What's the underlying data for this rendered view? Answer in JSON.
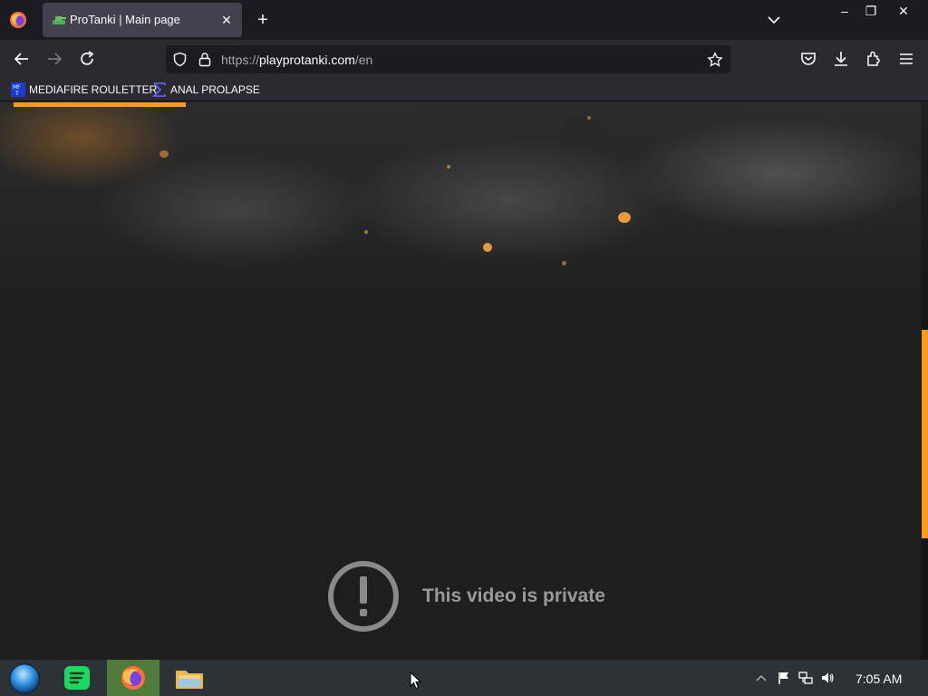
{
  "browser": {
    "tab": {
      "title": "ProTanki | Main page",
      "close_label": "✕"
    },
    "new_tab_label": "+",
    "window": {
      "minimize": "–",
      "restore": "❐",
      "close": "✕"
    },
    "url": {
      "scheme": "https://",
      "host": "playprotanki.com",
      "path": "/en"
    },
    "bookmarks": [
      {
        "label": "MEDIAFIRE ROULETTER",
        "icon": "mediafire-icon"
      },
      {
        "label": "ANAL PROLAPSE",
        "icon": "sigma-icon"
      }
    ],
    "accent": "#ff9a1f"
  },
  "page": {
    "video_message": "This video is private"
  },
  "taskbar": {
    "clock": "7:05 AM",
    "apps": [
      "start-orb",
      "spotify-icon",
      "firefox-icon",
      "file-explorer-icon"
    ],
    "tray": [
      "show-hidden-icons",
      "flag-icon",
      "network-icon",
      "volume-icon"
    ]
  }
}
